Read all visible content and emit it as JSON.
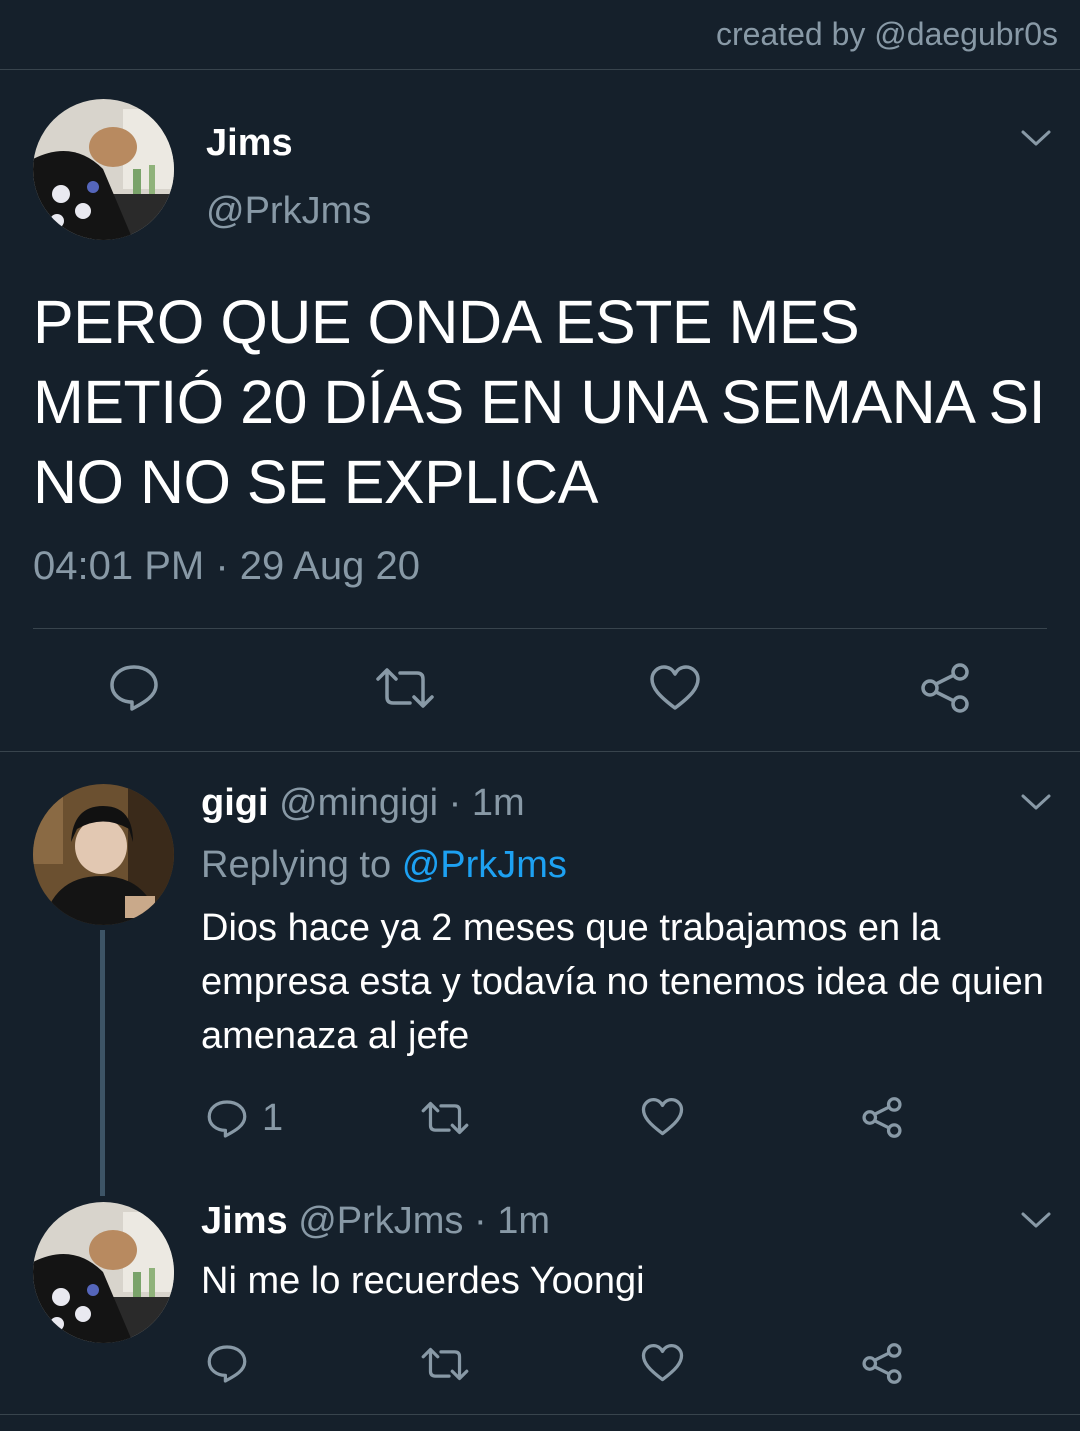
{
  "credit": "created by @daegubr0s",
  "main_tweet": {
    "name": "Jims",
    "handle": "@PrkJms",
    "text": "PERO QUE ONDA ESTE MES METIÓ 20 DÍAS EN UNA SEMANA SI NO NO SE EXPLICA",
    "timestamp": "04:01 PM · 29 Aug 20",
    "actions": [
      "reply-icon",
      "retweet-icon",
      "like-icon",
      "share-icon"
    ]
  },
  "replies": [
    {
      "name": "gigi",
      "handle": "@mingigi",
      "time": "· 1m",
      "replying_prefix": "Replying to",
      "replying_handle": "@PrkJms",
      "text": "Dios hace ya 2 meses que trabajamos en la empresa esta y todavía no tenemos idea de quien amenaza al jefe",
      "reply_count": "1"
    },
    {
      "name": "Jims",
      "handle": "@PrkJms",
      "time": "· 1m",
      "text": "Ni me lo recuerdes Yoongi"
    }
  ],
  "colors": {
    "background": "#15202b",
    "muted": "#8899a6",
    "link": "#1da1f2",
    "divider": "#38444d"
  }
}
